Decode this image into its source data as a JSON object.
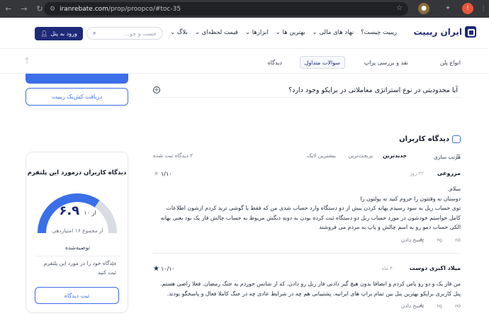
{
  "browser": {
    "url_host": "iranrebate.com",
    "url_path": "/prop/proopco/#toc-35"
  },
  "header": {
    "logo_text": "ایران ریبیت",
    "menu": [
      "ریبیت چیست؟",
      "نهاد های مالی ⌄",
      "بهترین ها ⌄",
      "ابزارها ⌄",
      "قیمت لحظه‌ای ⌄",
      "بلاگ ⌄"
    ],
    "search_placeholder": "جست و جو...",
    "login_label": "ورود به پنل"
  },
  "tabs": {
    "items": [
      "انواع پلن",
      "نقد و بررسی پراپ",
      "سوالات متداول",
      "دیدگاه"
    ],
    "active_index": 2
  },
  "sidebar": {
    "cashback_label": "دریافت کش‌بک ریبیت",
    "rating_title": "دیدگاه کاربران درمورد این پلتفرم",
    "score": "۶.۹",
    "score_max": "از ۱۰",
    "score_fraction": 0.69,
    "total_label": "از مجموع ۱۶ امتیازدهی",
    "recommend_label": "توصیه‌شده",
    "note": "دیدگاه خود را در مورد این پلتفرم ثبت کنید",
    "submit_label": "ثبت دیدگاه"
  },
  "faq": {
    "question": "آیا محدودیتی در نوع استراتژی معاملاتی در براپکو وجود دارد؟"
  },
  "comments": {
    "title": "دیدگاه کاربران",
    "sort_label": "مرتب سازی",
    "filters": [
      "جدیدترین",
      "پربحث‌ترین",
      "بیشترین لایک"
    ],
    "selected_filter": 0,
    "count_label": "۲ دیدگاه ثبت شده",
    "items": [
      {
        "name": "مزروعی",
        "date": "۲۲ روز",
        "score": "۱/۱۰",
        "stars_on": false,
        "body": "سلام.\nدوستان نه وقتتون را حروم کنید نه پولتون را\nتوی حساب ریل به سود رسیدم بهانه کردن بیش از دو دستگاه وارد حساب شدی من که فقط با گوشی ترید کردم ازشون اطلاعات کامل خواستم خودشون در مورد حساب ریل دو دستگاه ثبت کرده بودن به دونه دیگش مربوط به حساب چالش فاز یک بود بعنی بهانه الکی حساب دمو رو به اسم چالش و پاپ به مردم می فروشند",
        "reply": "پاسخ دادن",
        "likes": "۰",
        "dislikes": "۰"
      },
      {
        "name": "میلاد اکبری دوست",
        "date": "۴ ماه",
        "score": "۱۰/۱۰",
        "stars_on": true,
        "body": "من فاز یک و دو رو پاس کردم و انصافا بدون هیچ گیر دادنی فاز ریل رو دادن. که از شانس خوردم به جنگ رمضان. فعلا راضی هستم. پنل کاربری براپکو بهترین پنل بین تمام براپ های ایرانیه. پشتیبانی هم چه در شرایط عادی چه در جنگ کاملا فعال و پاسخگو بودند.",
        "reply": "پاسخ دادن",
        "likes": "۰",
        "dislikes": "۰"
      }
    ]
  },
  "colors": {
    "brand": "#1e2a78",
    "accent": "#3b6fe8",
    "gauge_track": "#d9dce3"
  }
}
